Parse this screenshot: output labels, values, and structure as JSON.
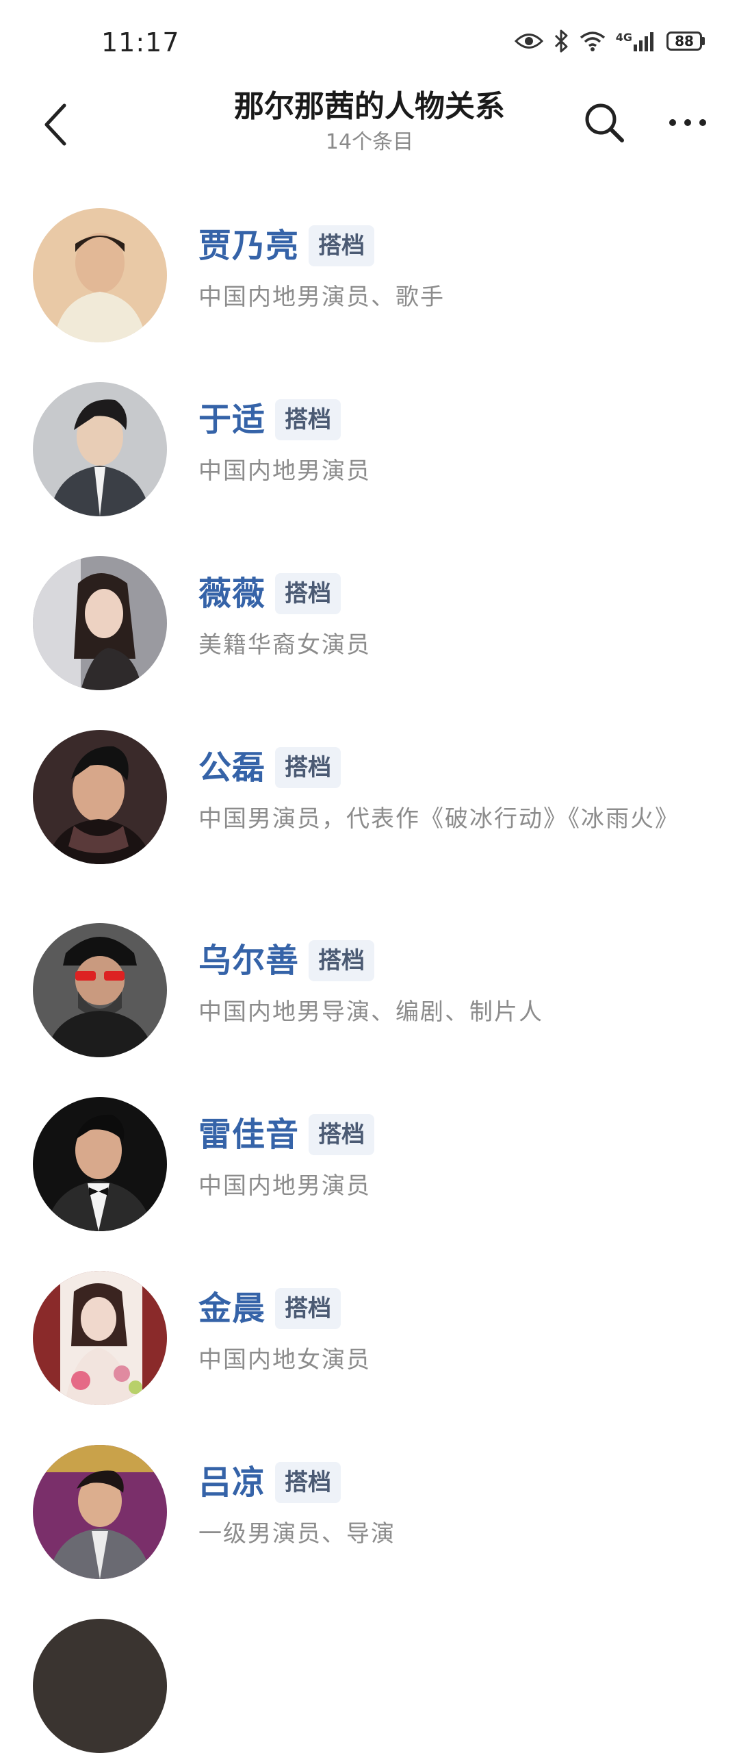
{
  "status_bar": {
    "time": "11:17",
    "network": "4G",
    "battery": "88"
  },
  "header": {
    "title": "那尔那茜的人物关系",
    "subtitle": "14个条目"
  },
  "people": [
    {
      "name": "贾乃亮",
      "tag": "搭档",
      "desc": "中国内地男演员、歌手",
      "avatar_bg": "#e9c9a6",
      "avatar_fg": "#f1ead8"
    },
    {
      "name": "于适",
      "tag": "搭档",
      "desc": "中国内地男演员",
      "avatar_bg": "#c7c9cc",
      "avatar_fg": "#3b3f46"
    },
    {
      "name": "薇薇",
      "tag": "搭档",
      "desc": "美籍华裔女演员",
      "avatar_bg": "#9a9aa0",
      "avatar_fg": "#2e2a2b"
    },
    {
      "name": "公磊",
      "tag": "搭档",
      "desc": "中国男演员，代表作《破冰行动》《冰雨火》",
      "avatar_bg": "#3a2a2a",
      "avatar_fg": "#1a1212"
    },
    {
      "name": "乌尔善",
      "tag": "搭档",
      "desc": "中国内地男导演、编剧、制片人",
      "avatar_bg": "#5a5a5a",
      "avatar_fg": "#1c1c1c"
    },
    {
      "name": "雷佳音",
      "tag": "搭档",
      "desc": "中国内地男演员",
      "avatar_bg": "#111111",
      "avatar_fg": "#2a2a2a"
    },
    {
      "name": "金晨",
      "tag": "搭档",
      "desc": "中国内地女演员",
      "avatar_bg": "#8a2a2a",
      "avatar_fg": "#f2e4de"
    },
    {
      "name": "吕凉",
      "tag": "搭档",
      "desc": "一级男演员、导演",
      "avatar_bg": "#7a2f6a",
      "avatar_fg": "#d6a43a"
    }
  ]
}
